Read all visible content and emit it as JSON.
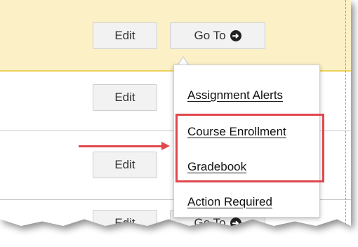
{
  "rows": [
    {
      "edit_label": "Edit",
      "goto_label": "Go To"
    },
    {
      "edit_label": "Edit"
    },
    {
      "edit_label": "Edit"
    },
    {
      "edit_label": "Edit",
      "goto_label": "Go To"
    }
  ],
  "goto_menu": {
    "items": [
      {
        "label": "Assignment Alerts"
      },
      {
        "label": "Course Enrollment"
      },
      {
        "label": "Gradebook"
      },
      {
        "label": "Action Required"
      }
    ]
  },
  "annotation": {
    "color": "#e0474c",
    "highlight_color": "#fcf1c6"
  },
  "icons": {
    "goto": "circle-arrow-right-icon"
  }
}
